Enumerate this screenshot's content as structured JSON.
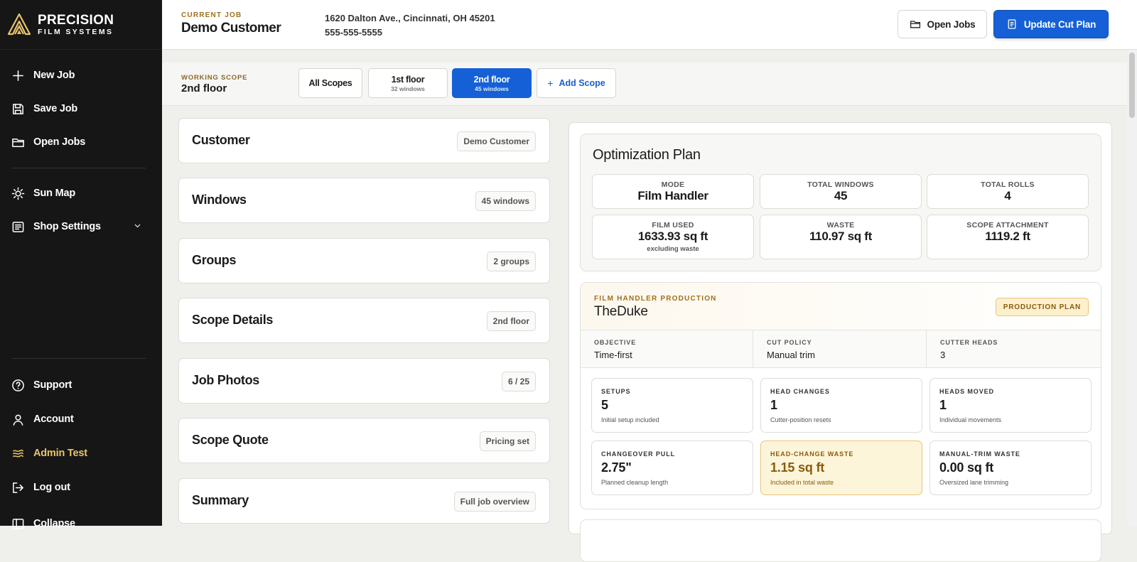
{
  "brand": {
    "name": "PRECISION",
    "subtitle": "FILM SYSTEMS"
  },
  "sidebar": {
    "items": [
      {
        "label": "New Job",
        "icon": "plus-icon"
      },
      {
        "label": "Save Job",
        "icon": "save-icon"
      },
      {
        "label": "Open Jobs",
        "icon": "folder-icon"
      },
      {
        "label": "Sun Map",
        "icon": "sun-icon"
      },
      {
        "label": "Shop Settings",
        "icon": "settings-doc-icon"
      },
      {
        "label": "Support",
        "icon": "help-circle-icon"
      },
      {
        "label": "Account",
        "icon": "user-icon"
      },
      {
        "label": "Admin Test",
        "icon": "admin-icon"
      },
      {
        "label": "Log out",
        "icon": "logout-icon"
      },
      {
        "label": "Collapse",
        "icon": "collapse-icon"
      }
    ]
  },
  "header": {
    "current_job_label": "CURRENT JOB",
    "customer_name": "Demo Customer",
    "address": "1620 Dalton Ave., Cincinnati, OH 45201",
    "phone": "555-555-5555",
    "open_jobs_label": "Open Jobs",
    "update_label": "Update Cut Plan"
  },
  "scope": {
    "working_label": "WORKING SCOPE",
    "working_name": "2nd floor",
    "chips": [
      {
        "label": "All Scopes",
        "sub": ""
      },
      {
        "label": "1st floor",
        "sub": "32 windows"
      },
      {
        "label": "2nd floor",
        "sub": "45 windows"
      }
    ],
    "add_label": "Add Scope"
  },
  "sections": [
    {
      "title": "Customer",
      "badge": "Demo Customer"
    },
    {
      "title": "Windows",
      "badge": "45 windows"
    },
    {
      "title": "Groups",
      "badge": "2 groups"
    },
    {
      "title": "Scope Details",
      "badge": "2nd floor"
    },
    {
      "title": "Job Photos",
      "badge": "6 / 25"
    },
    {
      "title": "Scope Quote",
      "badge": "Pricing set"
    },
    {
      "title": "Summary",
      "badge": "Full job overview"
    }
  ],
  "optimization": {
    "title": "Optimization Plan",
    "stats": [
      {
        "label": "MODE",
        "value": "Film Handler",
        "sub": ""
      },
      {
        "label": "TOTAL WINDOWS",
        "value": "45",
        "sub": ""
      },
      {
        "label": "TOTAL ROLLS",
        "value": "4",
        "sub": ""
      },
      {
        "label": "FILM USED",
        "value": "1633.93 sq ft",
        "sub": "excluding waste"
      },
      {
        "label": "WASTE",
        "value": "110.97 sq ft",
        "sub": ""
      },
      {
        "label": "SCOPE ATTACHMENT",
        "value": "1119.2 ft",
        "sub": ""
      }
    ]
  },
  "production": {
    "label": "FILM HANDLER PRODUCTION",
    "name": "TheDuke",
    "badge": "PRODUCTION PLAN",
    "meta": [
      {
        "label": "OBJECTIVE",
        "value": "Time-first"
      },
      {
        "label": "CUT POLICY",
        "value": "Manual trim"
      },
      {
        "label": "CUTTER HEADS",
        "value": "3"
      }
    ],
    "metrics": [
      {
        "label": "SETUPS",
        "value": "5",
        "sub": "Initial setup included"
      },
      {
        "label": "HEAD CHANGES",
        "value": "1",
        "sub": "Cutter-position resets"
      },
      {
        "label": "HEADS MOVED",
        "value": "1",
        "sub": "Individual movements"
      },
      {
        "label": "CHANGEOVER PULL",
        "value": "2.75\"",
        "sub": "Planned cleanup length"
      },
      {
        "label": "HEAD-CHANGE WASTE",
        "value": "1.15 sq ft",
        "sub": "Included in total waste"
      },
      {
        "label": "MANUAL-TRIM WASTE",
        "value": "0.00 sq ft",
        "sub": "Oversized lane trimming"
      }
    ]
  },
  "colors": {
    "accent": "#1560d6",
    "gold": "#e9c46a",
    "sidebar": "#161616"
  }
}
